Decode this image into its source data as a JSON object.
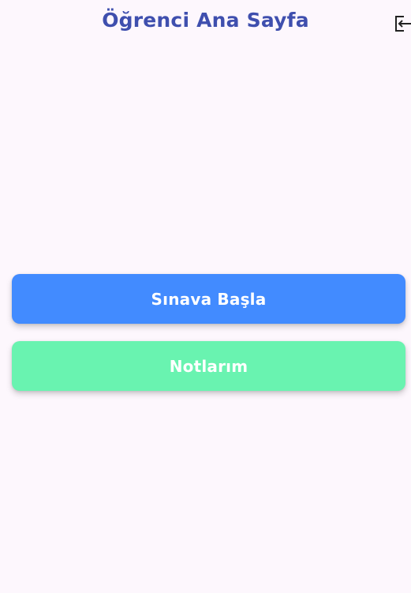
{
  "header": {
    "title": "Öğrenci Ana Sayfa",
    "logout_icon": "logout-icon"
  },
  "actions": {
    "start_exam_label": "Sınava Başla",
    "my_grades_label": "Notlarım"
  },
  "colors": {
    "background": "#fdf7fd",
    "title": "#3f4fae",
    "start_exam_button": "#428bff",
    "my_grades_button": "#69f3b0",
    "button_text": "#ffffff"
  }
}
